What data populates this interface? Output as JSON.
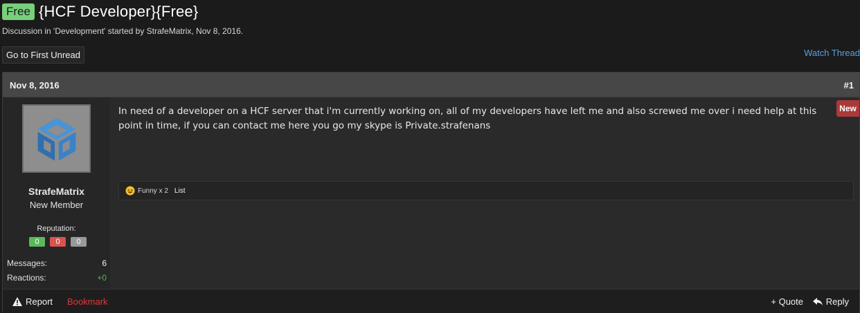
{
  "thread": {
    "prefix": "Free",
    "title": "{HCF Developer}{Free}",
    "meta": "Discussion in 'Development' started by StrafeMatrix, Nov 8, 2016."
  },
  "toolbar": {
    "first_unread_label": "Go to First Unread",
    "watch_label": "Watch Thread"
  },
  "post": {
    "date": "Nov 8, 2016",
    "number": "#1",
    "new_badge": "New",
    "body": "In need of a developer on a HCF server that i'm currently working on, all of my developers have left me and also screwed me over i need help at this point in time, if you can contact me here you go my skype is Private.strafenans",
    "reactions": {
      "text": "Funny x 2",
      "list_label": "List",
      "icon": "laughing-face-icon"
    }
  },
  "user": {
    "avatar_icon": "blue-cube-avatar",
    "name": "StrafeMatrix",
    "title": "New Member",
    "reputation_label": "Reputation:",
    "reputation": {
      "positive": "0",
      "negative": "0",
      "neutral": "0"
    },
    "stats": {
      "messages_label": "Messages:",
      "messages_value": "6",
      "reactions_label": "Reactions:",
      "reactions_value": "+0"
    }
  },
  "footer": {
    "report_label": "Report",
    "report_icon": "warning-icon",
    "bookmark_label": "Bookmark",
    "quote_label": "+ Quote",
    "reply_label": "Reply",
    "reply_icon": "reply-arrow-icon"
  },
  "colors": {
    "prefix_bg": "#77d07a",
    "link_blue": "#5aa0e0",
    "bookmark_red": "#e0383b",
    "new_badge_bg": "#a93a3a",
    "rep_positive": "#5cb85c",
    "rep_negative": "#d9534f",
    "rep_neutral": "#999999"
  }
}
